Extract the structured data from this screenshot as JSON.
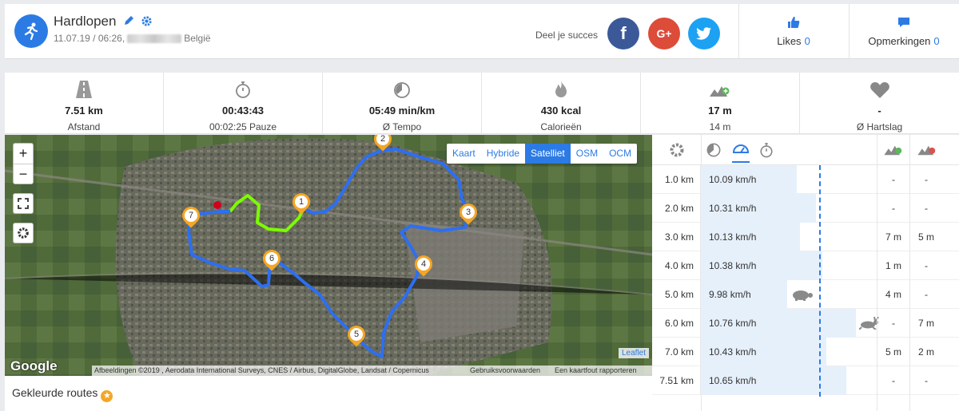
{
  "activity": {
    "title": "Hardlopen",
    "date_time": "11.07.19 / 06:26,",
    "country": "België"
  },
  "share": {
    "label": "Deel je succes",
    "facebook": "f",
    "googleplus": "G+"
  },
  "likes": {
    "label": "Likes",
    "count": "0"
  },
  "comments": {
    "label": "Opmerkingen",
    "count": "0"
  },
  "stats": [
    {
      "icon": "road-icon",
      "value": "7.51 km",
      "label": "Afstand"
    },
    {
      "icon": "stopwatch-icon",
      "value": "00:43:43",
      "label": "00:02:25 Pauze"
    },
    {
      "icon": "pace-icon",
      "value": "05:49 min/km",
      "label": "Ø Tempo"
    },
    {
      "icon": "flame-icon",
      "value": "430 kcal",
      "label": "Calorieën"
    },
    {
      "icon": "elevation-up-icon",
      "value": "17 m",
      "label": "14 m"
    },
    {
      "icon": "heart-icon",
      "value": "-",
      "label": "Ø Hartslag"
    }
  ],
  "map": {
    "layers": [
      "Kaart",
      "Hybride",
      "Satelliet",
      "OSM",
      "OCM"
    ],
    "active_layer": "Satelliet",
    "zoom_in": "+",
    "zoom_out": "−",
    "google": "Google",
    "attribution": "Afbeeldingen ©2019 , Aerodata International Surveys, CNES / Airbus, DigitalGlobe, Landsat / Copernicus",
    "terms": "Gebruiksvoorwaarden",
    "report": "Een kaartfout rapporteren",
    "leaflet": "Leaflet",
    "markers": [
      "1",
      "2",
      "3",
      "4",
      "5",
      "6",
      "7"
    ]
  },
  "colored_routes": "Gekleurde routes",
  "splits": [
    {
      "km": "1.0 km",
      "speed": "10.09 km/h",
      "speed_value": 10.09,
      "up": "-",
      "down": "-",
      "animal": ""
    },
    {
      "km": "2.0 km",
      "speed": "10.31 km/h",
      "speed_value": 10.31,
      "up": "-",
      "down": "-",
      "animal": ""
    },
    {
      "km": "3.0 km",
      "speed": "10.13 km/h",
      "speed_value": 10.13,
      "up": "7 m",
      "down": "5 m",
      "animal": ""
    },
    {
      "km": "4.0 km",
      "speed": "10.38 km/h",
      "speed_value": 10.38,
      "up": "1 m",
      "down": "-",
      "animal": ""
    },
    {
      "km": "5.0 km",
      "speed": "9.98 km/h",
      "speed_value": 9.98,
      "up": "4 m",
      "down": "-",
      "animal": "turtle-icon"
    },
    {
      "km": "6.0 km",
      "speed": "10.76 km/h",
      "speed_value": 10.76,
      "up": "-",
      "down": "7 m",
      "animal": "rabbit-icon"
    },
    {
      "km": "7.0 km",
      "speed": "10.43 km/h",
      "speed_value": 10.43,
      "up": "5 m",
      "down": "2 m",
      "animal": ""
    },
    {
      "km": "7.51 km",
      "speed": "10.65 km/h",
      "speed_value": 10.65,
      "up": "-",
      "down": "-",
      "animal": ""
    }
  ],
  "colors": {
    "accent": "#2c7be5",
    "marker": "#f5a623",
    "route": "#2d6ff0",
    "route_start": "#7cfc00"
  }
}
